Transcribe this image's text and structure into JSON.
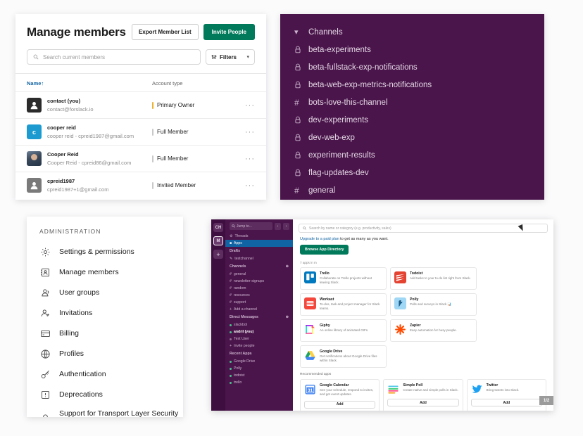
{
  "members_panel": {
    "title": "Manage members",
    "export_label": "Export Member List",
    "invite_label": "Invite People",
    "search_placeholder": "Search current members",
    "filters_label": "Filters",
    "filters_icon": "sliders-icon",
    "search_icon": "search-icon",
    "columns": {
      "name": "Name",
      "sort_arrow": "↑",
      "account_type": "Account type"
    },
    "rows": [
      {
        "name": "contact (you)",
        "email": "contact@forslack.io",
        "type": "Primary Owner",
        "type_color": "#ecb22e",
        "avatar_kind": "default",
        "avatar_letter": "",
        "more": "···"
      },
      {
        "name": "cooper reid",
        "email": "cooper reid - cpreid1987@gmail.com",
        "type": "Full Member",
        "type_color": "#c9c9c9",
        "avatar_kind": "blue",
        "avatar_letter": "c",
        "more": "···"
      },
      {
        "name": "Cooper Reid",
        "email": "Cooper Reid - cpreid86@gmail.com",
        "type": "Full Member",
        "type_color": "#c9c9c9",
        "avatar_kind": "photo",
        "avatar_letter": "",
        "more": "···"
      },
      {
        "name": "cpreid1987",
        "email": "cpreid1987+1@gmail.com",
        "type": "Invited Member",
        "type_color": "#c9c9c9",
        "avatar_kind": "gray",
        "avatar_letter": "",
        "more": "···"
      }
    ]
  },
  "channels_panel": {
    "background": "#4a154b",
    "header": {
      "label": "Channels",
      "icon": "chevron-down-icon"
    },
    "items": [
      {
        "label": "beta-experiments",
        "icon": "lock-icon"
      },
      {
        "label": "beta-fullstack-exp-notifications",
        "icon": "lock-icon"
      },
      {
        "label": "beta-web-exp-metrics-notifications",
        "icon": "lock-icon"
      },
      {
        "label": "bots-love-this-channel",
        "icon": "hash-icon"
      },
      {
        "label": "dev-experiments",
        "icon": "lock-icon"
      },
      {
        "label": "dev-web-exp",
        "icon": "lock-icon"
      },
      {
        "label": "experiment-results",
        "icon": "lock-icon"
      },
      {
        "label": "flag-updates-dev",
        "icon": "lock-icon"
      },
      {
        "label": "general",
        "icon": "hash-icon"
      }
    ]
  },
  "admin_panel": {
    "title": "ADMINISTRATION",
    "items": [
      {
        "label": "Settings & permissions",
        "icon": "gear-icon"
      },
      {
        "label": "Manage members",
        "icon": "contact-card-icon"
      },
      {
        "label": "User groups",
        "icon": "user-group-icon"
      },
      {
        "label": "Invitations",
        "icon": "user-plus-icon"
      },
      {
        "label": "Billing",
        "icon": "credit-card-icon"
      },
      {
        "label": "Profiles",
        "icon": "globe-icon"
      },
      {
        "label": "Authentication",
        "icon": "key-icon"
      },
      {
        "label": "Deprecations",
        "icon": "alert-box-icon"
      },
      {
        "label": "Support for Transport Layer Security (TLS)",
        "icon": "lock-icon"
      }
    ]
  },
  "slack_window": {
    "rail": {
      "badges": [
        "CH",
        "M"
      ],
      "active_index": 1,
      "add_label": "+"
    },
    "sidebar": {
      "jump_placeholder": "Jump to...",
      "back_icon": "chevron-left-icon",
      "forward_icon": "chevron-right-icon",
      "top_items": [
        {
          "label": "Threads",
          "icon": "threads-icon",
          "selected": false
        },
        {
          "label": "Apps",
          "icon": "apps-icon",
          "selected": true
        }
      ],
      "drafts_section": "Drafts",
      "drafts_items": [
        {
          "label": "testchannel",
          "icon": "pencil-icon"
        }
      ],
      "channels_section": "Channels",
      "channels_add_icon": "plus-circle-icon",
      "channels": [
        "general",
        "newsletter-signups",
        "random",
        "resources",
        "support"
      ],
      "add_channel_label": "Add a channel",
      "dm_section": "Direct Messages",
      "dm_add_icon": "plus-circle-icon",
      "dms": [
        {
          "label": "slackbot",
          "dot": "#4ac18e",
          "shape": "heart"
        },
        {
          "label": "andril  (you)",
          "dot": "#4ac18e",
          "bold": true
        },
        {
          "label": "Test User",
          "dot": "#8f6a90"
        }
      ],
      "invite_label": "Invite people",
      "recent_apps_section": "Recent Apps",
      "recent_apps": [
        {
          "label": "Google Drive",
          "dot": "#4ac18e"
        },
        {
          "label": "Polly",
          "dot": "#4ac18e"
        },
        {
          "label": "todoist",
          "dot": "#4ac18e"
        },
        {
          "label": "trello",
          "dot": "#4ac18e"
        }
      ]
    },
    "main": {
      "search_placeholder": "Search by name or category (e.g. productivity, sales)",
      "search_icon": "search-icon",
      "upgrade_link": "Upgrade to a paid plan",
      "upgrade_rest": " to get as many as you want.",
      "browse_label": "Browse App Directory",
      "count_label": "7 apps in m",
      "installed_apps": [
        {
          "name": "Trello",
          "desc": "Collaborate on Trello projects without leaving Slack.",
          "icon": "trello-icon",
          "color": "#0079bf"
        },
        {
          "name": "Todoist",
          "desc": "Add tasks to your to-do list right from Slack.",
          "icon": "todoist-icon",
          "color": "#e44332"
        },
        {
          "name": "Workast",
          "desc": "To-dos, task and project manager for Slack teams.",
          "icon": "workast-icon",
          "color": "#f4483d"
        },
        {
          "name": "Polly",
          "desc": "Polls and surveys in Slack 📊",
          "icon": "polly-icon",
          "color": "#9fd7f5"
        },
        {
          "name": "Giphy",
          "desc": "An online library of animated GIFs.",
          "icon": "giphy-icon",
          "color": "#00e6cc"
        },
        {
          "name": "Zapier",
          "desc": "Easy automation for busy people.",
          "icon": "zapier-icon",
          "color": "#ff4a00"
        },
        {
          "name": "Google Drive",
          "desc": "Get notifications about Google Drive files within Slack.",
          "icon": "google-drive-icon",
          "color": "#2ba24c"
        }
      ],
      "recommended_title": "Recommended apps",
      "recommended_apps": [
        {
          "name": "Google Calendar",
          "desc": "See your schedule, respond to invites, and get event updates.",
          "icon": "google-calendar-icon",
          "add_label": "Add"
        },
        {
          "name": "Simple Poll",
          "desc": "Create native and simple polls in Slack.",
          "icon": "simple-poll-icon",
          "add_label": "Add"
        },
        {
          "name": "Twitter",
          "desc": "Bring tweets into Slack.",
          "icon": "twitter-icon",
          "add_label": "Add"
        }
      ],
      "corner_badge": "1/2"
    }
  }
}
